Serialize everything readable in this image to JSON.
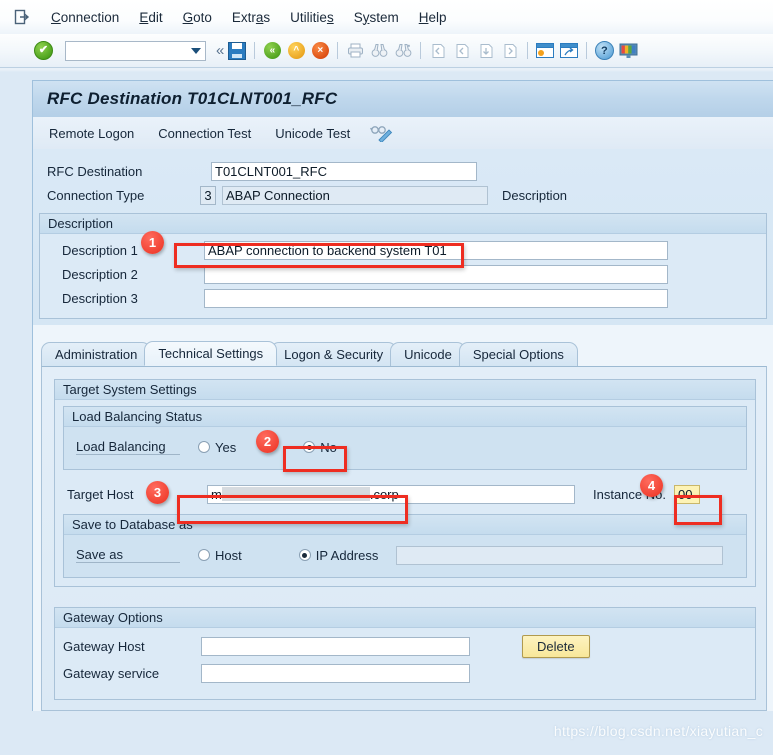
{
  "menu": {
    "system_icon": "exit-door-icon",
    "items": [
      {
        "label": "Connection",
        "accel": "C"
      },
      {
        "label": "Edit",
        "accel": "E"
      },
      {
        "label": "Goto",
        "accel": "G"
      },
      {
        "label": "Extras",
        "accel": "a"
      },
      {
        "label": "Utilities",
        "accel": "s"
      },
      {
        "label": "System",
        "accel": "y"
      },
      {
        "label": "Help",
        "accel": "H"
      }
    ]
  },
  "toolbar": {
    "enter_icon": "green-check-icon",
    "command_field_value": "",
    "command_field_placeholder": "",
    "dropdown_icon": "caret-down-icon",
    "history_icon": "double-chevron-left-icon",
    "save_icon": "save-disk-icon",
    "back_icon": "green-back-arrow-icon",
    "exit_icon": "yellow-up-arrow-icon",
    "cancel_icon": "orange-cancel-icon",
    "print_icon": "printer-icon",
    "find_icon": "binoculars-icon",
    "find_next_icon": "binoculars-plus-icon",
    "first_page_icon": "first-page-icon",
    "prev_page_icon": "previous-page-icon",
    "next_page_icon": "next-page-icon",
    "last_page_icon": "last-page-icon",
    "create_session_icon": "create-session-icon",
    "shortcut_icon": "create-shortcut-icon",
    "help_icon": "help-question-icon",
    "layout_icon": "customize-local-layout-icon"
  },
  "screen": {
    "title": "RFC Destination T01CLNT001_RFC",
    "app_buttons": [
      {
        "label": "Remote Logon"
      },
      {
        "label": "Connection Test"
      },
      {
        "label": "Unicode Test"
      }
    ],
    "unicode_test_icon": "glasses-pen-icon"
  },
  "header_fields": {
    "rfc_destination_label": "RFC Destination",
    "rfc_destination_value": "T01CLNT001_RFC",
    "connection_type_label": "Connection Type",
    "connection_type_code": "3",
    "connection_type_text": "ABAP Connection",
    "description_col_label": "Description"
  },
  "description_group": {
    "title": "Description",
    "rows": [
      {
        "label": "Description 1",
        "value": "ABAP connection to backend system T01"
      },
      {
        "label": "Description 2",
        "value": ""
      },
      {
        "label": "Description 3",
        "value": ""
      }
    ]
  },
  "tabs": [
    {
      "label": "Administration",
      "active": false
    },
    {
      "label": "Technical Settings",
      "active": true
    },
    {
      "label": "Logon & Security",
      "active": false
    },
    {
      "label": "Unicode",
      "active": false
    },
    {
      "label": "Special Options",
      "active": false
    }
  ],
  "target_system": {
    "title": "Target System Settings",
    "load_balancing_group_title": "Load Balancing Status",
    "load_balancing_label": "Load Balancing",
    "load_balancing_yes_label": "Yes",
    "load_balancing_no_label": "No",
    "load_balancing_selected": "No",
    "target_host_label": "Target Host",
    "target_host_prefix": "m",
    "target_host_suffix": ".corp",
    "instance_no_label": "Instance No.",
    "instance_no_value": "00",
    "save_to_db_group_title": "Save to Database as",
    "save_as_label": "Save as",
    "save_as_host_label": "Host",
    "save_as_ip_label": "IP Address",
    "save_as_selected": "IP Address",
    "save_as_ip_value": ""
  },
  "gateway": {
    "title": "Gateway Options",
    "host_label": "Gateway Host",
    "host_value": "",
    "service_label": "Gateway service",
    "service_value": "",
    "delete_button_label": "Delete"
  },
  "callouts": [
    {
      "number": "1",
      "target": "description-1-field"
    },
    {
      "number": "2",
      "target": "load-balancing-no-radio"
    },
    {
      "number": "3",
      "target": "target-host-field"
    },
    {
      "number": "4",
      "target": "instance-no-field"
    }
  ],
  "watermark": "https://blog.csdn.net/xiayutian_c",
  "colors": {
    "accent_blue": "#2b7cc0",
    "callout_red": "#ee2d21",
    "focus_yellow": "#fdf3b5",
    "button_yellow": "#f8e79a",
    "panel_blue": "#dceaf6"
  }
}
